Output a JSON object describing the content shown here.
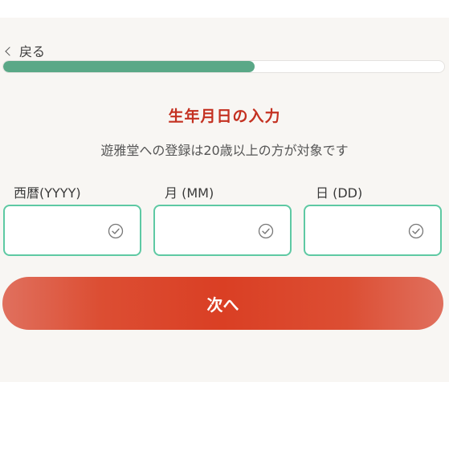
{
  "nav": {
    "back_label": "戻る"
  },
  "progress": {
    "fraction": 0.57
  },
  "header": {
    "title": "生年月日の入力",
    "subtitle": "遊雅堂への登録は20歳以上の方が対象です"
  },
  "fields": [
    {
      "label": "西暦(YYYY)",
      "value": ""
    },
    {
      "label": "月 (MM)",
      "value": ""
    },
    {
      "label": "日 (DD)",
      "value": ""
    }
  ],
  "actions": {
    "next_label": "次へ"
  },
  "icons": {
    "back": "chevron-left-icon",
    "valid": "check-circle-icon"
  },
  "colors": {
    "accent_red": "#c43121",
    "button_red": "#da3f24",
    "progress_green": "#5aa887",
    "field_border": "#5ec9a3"
  }
}
